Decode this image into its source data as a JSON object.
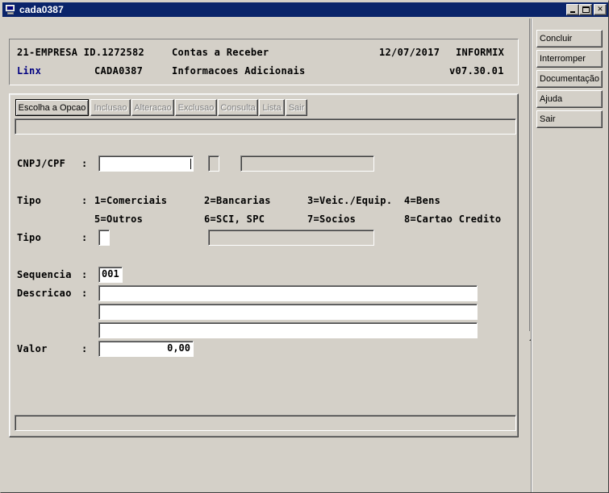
{
  "window": {
    "title": "cada0387",
    "icon": "computer-icon"
  },
  "header": {
    "line1": {
      "company": "21-EMPRESA ID.1272582",
      "module": "Contas a Receber",
      "date": "12/07/2017",
      "db": "INFORMIX"
    },
    "line2": {
      "brand": "Linx",
      "program": "CADA0387",
      "screen": "Informacoes Adicionais",
      "version": "v07.30.01"
    }
  },
  "toolbar": {
    "buttons": [
      {
        "label": "Escolha a Opcao",
        "enabled": true
      },
      {
        "label": "Inclusao",
        "enabled": false
      },
      {
        "label": "Alteracao",
        "enabled": false
      },
      {
        "label": "Exclusao",
        "enabled": false
      },
      {
        "label": "Consulta",
        "enabled": false
      },
      {
        "label": "Lista",
        "enabled": false
      },
      {
        "label": "Sair",
        "enabled": false
      }
    ]
  },
  "form": {
    "cnpj": {
      "label": "CNPJ/CPF",
      "sep": ":",
      "value": ""
    },
    "tipo_options": {
      "label": "Tipo",
      "sep": ":",
      "row1": [
        "1=Comerciais",
        "2=Bancarias",
        "3=Veic./Equip.",
        "4=Bens"
      ],
      "row2": [
        "5=Outros",
        "6=SCI, SPC",
        "7=Socios",
        "8=Cartao Credito"
      ]
    },
    "tipo": {
      "label": "Tipo",
      "sep": ":",
      "value": ""
    },
    "sequencia": {
      "label": "Sequencia",
      "sep": ":",
      "value": "001"
    },
    "descricao": {
      "label": "Descricao",
      "sep": ":",
      "lines": [
        "",
        "",
        ""
      ]
    },
    "valor": {
      "label": "Valor",
      "sep": ":",
      "value": "0,00"
    }
  },
  "side_buttons": [
    {
      "label": "Concluir"
    },
    {
      "label": "Interromper"
    },
    {
      "label": "Documentação"
    },
    {
      "label": "Ajuda"
    },
    {
      "label": "Sair"
    }
  ],
  "colors": {
    "titlebar": "#0a246a",
    "face": "#d4d0c8",
    "brand": "#000080"
  }
}
